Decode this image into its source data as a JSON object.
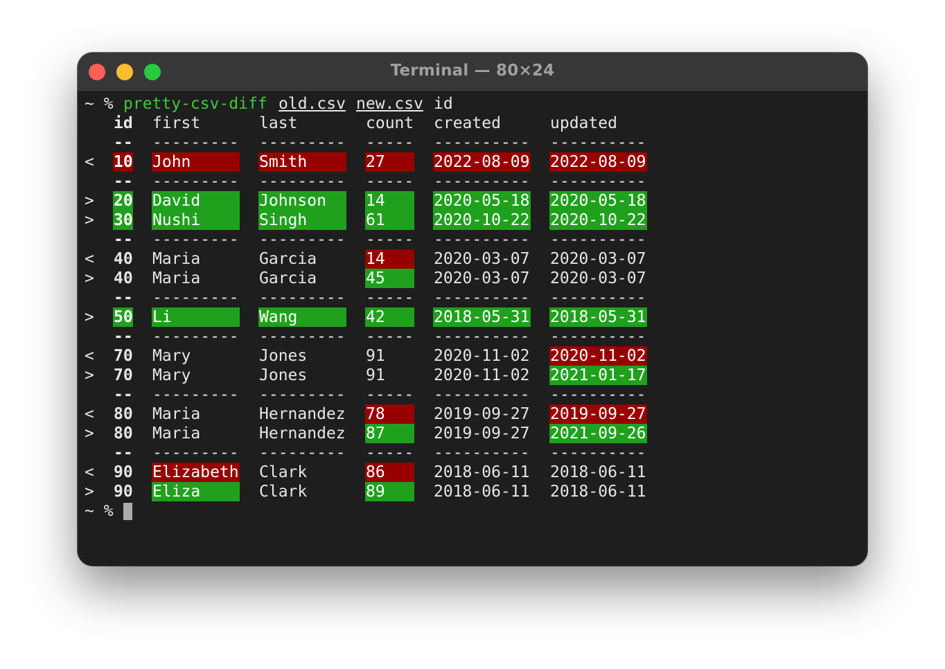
{
  "window": {
    "title": "Terminal — 80×24"
  },
  "command": {
    "prompt": "~ %",
    "program": "pretty-csv-diff",
    "arg1": "old.csv",
    "arg2": "new.csv",
    "arg3": "id"
  },
  "header": {
    "id": "id",
    "first": "first",
    "last": "last",
    "count": "count",
    "created": "created",
    "updated": "updated"
  },
  "separators": {
    "id": "--",
    "first": "---------",
    "last": "---------",
    "count": "-----",
    "created": "----------",
    "updated": "----------"
  },
  "groups": [
    {
      "rows": [
        {
          "marker": "<",
          "id": "10",
          "first": "John",
          "last": "Smith",
          "count": "27",
          "created": "2022-08-09",
          "updated": "2022-08-09",
          "hl": {
            "id": "red",
            "first": "red",
            "last": "red",
            "count": "red",
            "created": "red",
            "updated": "red"
          }
        }
      ]
    },
    {
      "rows": [
        {
          "marker": ">",
          "id": "20",
          "first": "David",
          "last": "Johnson",
          "count": "14",
          "created": "2020-05-18",
          "updated": "2020-05-18",
          "hl": {
            "id": "green",
            "first": "green",
            "last": "green",
            "count": "green",
            "created": "green",
            "updated": "green"
          }
        },
        {
          "marker": ">",
          "id": "30",
          "first": "Nushi",
          "last": "Singh",
          "count": "61",
          "created": "2020-10-22",
          "updated": "2020-10-22",
          "hl": {
            "id": "green",
            "first": "green",
            "last": "green",
            "count": "green",
            "created": "green",
            "updated": "green"
          }
        }
      ]
    },
    {
      "rows": [
        {
          "marker": "<",
          "id": "40",
          "first": "Maria",
          "last": "Garcia",
          "count": "14",
          "created": "2020-03-07",
          "updated": "2020-03-07",
          "hl": {
            "count": "red"
          }
        },
        {
          "marker": ">",
          "id": "40",
          "first": "Maria",
          "last": "Garcia",
          "count": "45",
          "created": "2020-03-07",
          "updated": "2020-03-07",
          "hl": {
            "count": "green"
          }
        }
      ]
    },
    {
      "rows": [
        {
          "marker": ">",
          "id": "50",
          "first": "Li",
          "last": "Wang",
          "count": "42",
          "created": "2018-05-31",
          "updated": "2018-05-31",
          "hl": {
            "id": "green",
            "first": "green",
            "last": "green",
            "count": "green",
            "created": "green",
            "updated": "green"
          }
        }
      ]
    },
    {
      "rows": [
        {
          "marker": "<",
          "id": "70",
          "first": "Mary",
          "last": "Jones",
          "count": "91",
          "created": "2020-11-02",
          "updated": "2020-11-02",
          "hl": {
            "updated": "red"
          }
        },
        {
          "marker": ">",
          "id": "70",
          "first": "Mary",
          "last": "Jones",
          "count": "91",
          "created": "2020-11-02",
          "updated": "2021-01-17",
          "hl": {
            "updated": "green"
          }
        }
      ]
    },
    {
      "rows": [
        {
          "marker": "<",
          "id": "80",
          "first": "Maria",
          "last": "Hernandez",
          "count": "78",
          "created": "2019-09-27",
          "updated": "2019-09-27",
          "hl": {
            "count": "red",
            "updated": "red"
          }
        },
        {
          "marker": ">",
          "id": "80",
          "first": "Maria",
          "last": "Hernandez",
          "count": "87",
          "created": "2019-09-27",
          "updated": "2021-09-26",
          "hl": {
            "count": "green",
            "updated": "green"
          }
        }
      ]
    },
    {
      "rows": [
        {
          "marker": "<",
          "id": "90",
          "first": "Elizabeth",
          "last": "Clark",
          "count": "86",
          "created": "2018-06-11",
          "updated": "2018-06-11",
          "hl": {
            "first": "red",
            "count": "red"
          }
        },
        {
          "marker": ">",
          "id": "90",
          "first": "Eliza",
          "last": "Clark",
          "count": "89",
          "created": "2018-06-11",
          "updated": "2018-06-11",
          "hl": {
            "first": "green",
            "count": "green"
          }
        }
      ]
    }
  ],
  "final_prompt": "~ %",
  "colors": {
    "removed": "#990000",
    "added": "#1fa11d",
    "command": "#3fc93c",
    "text": "#e6e6e6",
    "background": "#1e1e1e"
  }
}
